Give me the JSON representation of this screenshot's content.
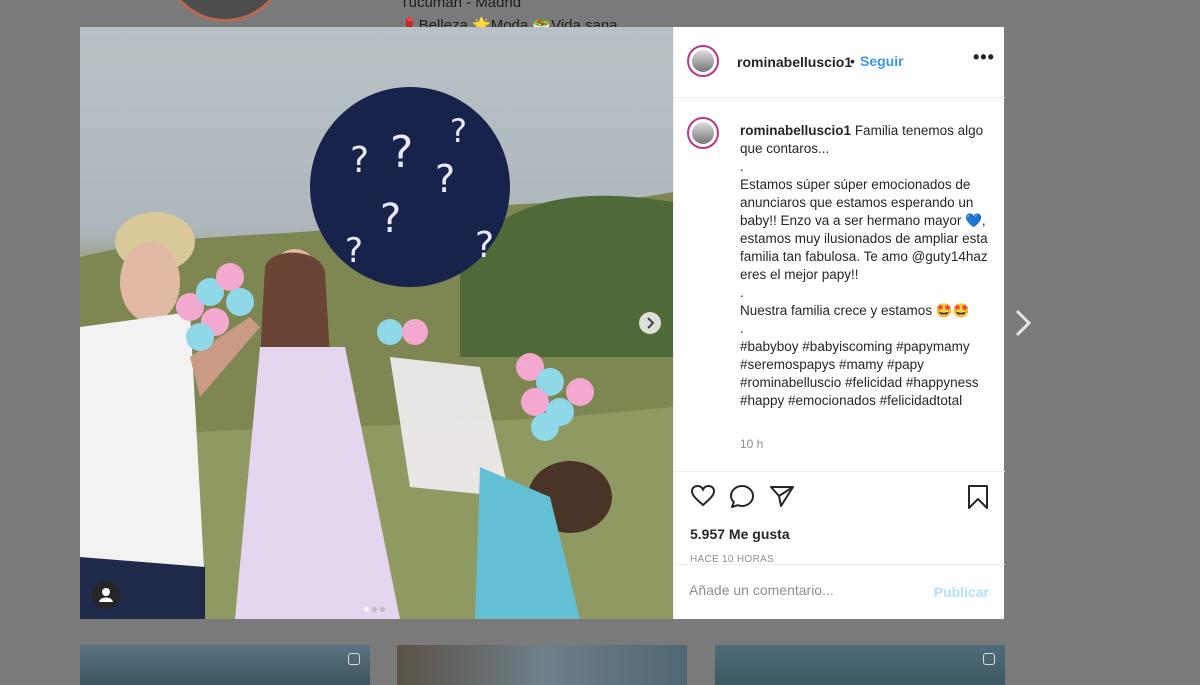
{
  "background": {
    "location_line": "Tucumán - Madrid",
    "tags_line": "💄Belleza 🌟Moda 🥗Vida sana"
  },
  "post": {
    "username": "rominabelluscio1",
    "separator": "•",
    "follow_label": "Seguir",
    "more_label": "•••",
    "caption": {
      "username": "rominabelluscio1",
      "lines": [
        "Familia tenemos algo que contaros...",
        ".",
        "Estamos súper súper emocionados de anunciaros que estamos esperando un baby!! Enzo va a ser hermano mayor 💙, estamos muy ilusionados de ampliar esta familia tan fabulosa. Te amo @guty14haz eres el mejor papy!!",
        ".",
        "Nuestra familia crece y estamos 🤩🤩",
        ".",
        "#babyboy #babyiscoming #papymamy #seremospapys #mamy #papy #rominabelluscio #felicidad #happyness #happy #emocionados #felicidadtotal"
      ]
    },
    "time_ago": "10 h",
    "likes": "5.957 Me gusta",
    "posted": "HACE 10 HORAS",
    "comment_placeholder": "Añade un comentario...",
    "publish_label": "Publicar",
    "icons": {
      "like": "heart-icon",
      "comment": "comment-icon",
      "share": "share-icon",
      "save": "bookmark-icon",
      "next": "chevron-right-icon",
      "photo_next": "chevron-right-icon",
      "tag": "user-tag-icon"
    },
    "carousel": {
      "slides": 3,
      "active": 1
    }
  },
  "colors": {
    "link": "#3897f0",
    "publish_disabled": "#b2dffc",
    "story_ring": "#c13584"
  }
}
